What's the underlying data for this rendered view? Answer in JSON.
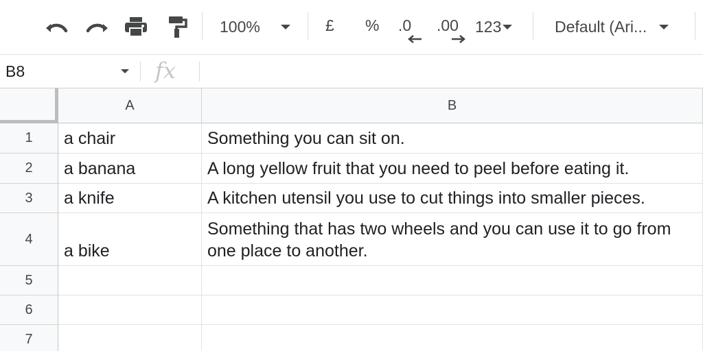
{
  "toolbar": {
    "icons": [
      "undo-icon",
      "redo-icon",
      "print-icon",
      "paint-format-icon"
    ],
    "zoom": "100%",
    "currency": "£",
    "percent": "%",
    "decrease_decimal": ".0",
    "increase_decimal": ".00",
    "more_formats": "123",
    "font": "Default (Ari..."
  },
  "formula_bar": {
    "cell_ref": "B8",
    "fx_label": "fx",
    "value": ""
  },
  "grid": {
    "columns": [
      "A",
      "B"
    ],
    "rows": [
      {
        "num": "1",
        "a": "a chair",
        "b": "Something you can sit on."
      },
      {
        "num": "2",
        "a": "a banana",
        "b": "A long yellow fruit that you need to peel before eating it."
      },
      {
        "num": "3",
        "a": "a knife",
        "b": "A kitchen utensil you use to cut things into smaller pieces."
      },
      {
        "num": "4",
        "a": "a bike",
        "b": "Something that has two wheels and you can use it to go from one place to another."
      },
      {
        "num": "5",
        "a": "",
        "b": ""
      },
      {
        "num": "6",
        "a": "",
        "b": ""
      },
      {
        "num": "7",
        "a": "",
        "b": ""
      }
    ]
  }
}
